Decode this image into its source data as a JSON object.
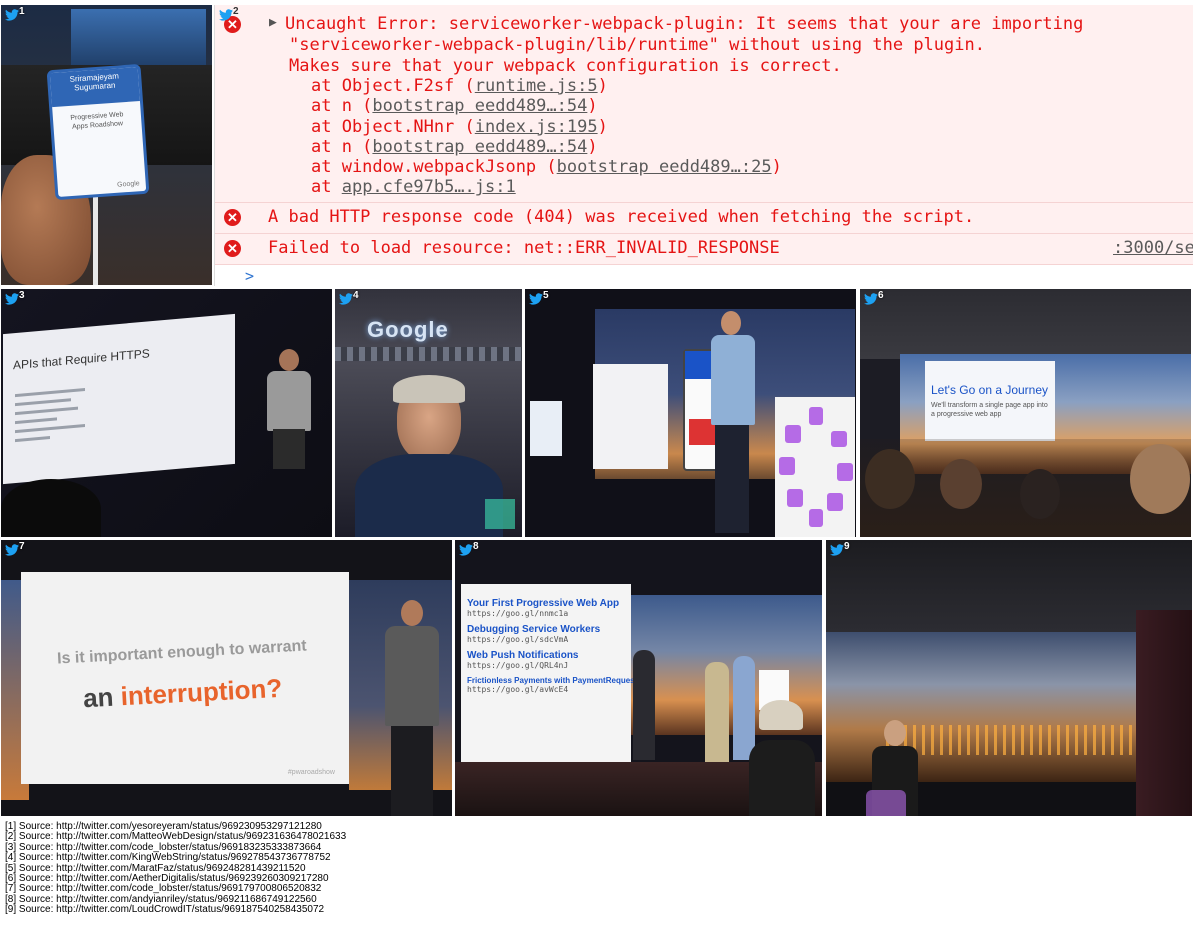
{
  "tiles": [
    {
      "number": "1"
    },
    {
      "number": "2"
    },
    {
      "number": "3"
    },
    {
      "number": "4"
    },
    {
      "number": "5"
    },
    {
      "number": "6"
    },
    {
      "number": "7"
    },
    {
      "number": "8"
    },
    {
      "number": "9"
    }
  ],
  "photo1": {
    "badge_name_line1": "Sriramajeyam",
    "badge_name_line2": "Sugumaran",
    "badge_sub": "Progressive Web Apps Roadshow",
    "badge_logo": "Google"
  },
  "console": {
    "error1": {
      "l1": "Uncaught Error: serviceworker-webpack-plugin: It seems that your are importing",
      "l2": "\"serviceworker-webpack-plugin/lib/runtime\" without using the plugin.",
      "l3": "Makes sure that your webpack configuration is correct.",
      "stack": [
        {
          "prefix": "at Object.F2sf (",
          "link": "runtime.js:5",
          "suffix": ")"
        },
        {
          "prefix": "at n (",
          "link": "bootstrap eedd489…:54",
          "suffix": ")"
        },
        {
          "prefix": "at Object.NHnr (",
          "link": "index.js:195",
          "suffix": ")"
        },
        {
          "prefix": "at n (",
          "link": "bootstrap eedd489…:54",
          "suffix": ")"
        },
        {
          "prefix": "at window.webpackJsonp (",
          "link": "bootstrap eedd489…:25",
          "suffix": ")"
        },
        {
          "prefix": "at ",
          "link": "app.cfe97b5….js:1",
          "suffix": ""
        }
      ]
    },
    "error2": "A bad HTTP response code (404) was received when fetching the script.",
    "error3": "Failed to load resource: net::ERR_INVALID_RESPONSE",
    "error3_link": ":3000/se",
    "prompt": ">"
  },
  "photo3": {
    "slide_title": "APIs that Require HTTPS"
  },
  "photo4": {
    "sign": "Google"
  },
  "photo6": {
    "slide_title": "Let's Go on a Journey",
    "slide_sub": "We'll transform a single page app into a progressive web app"
  },
  "photo7": {
    "line1": "Is it important enough to warrant",
    "line2a": "an ",
    "line2b": "interruption?",
    "accent": "#e8642c",
    "hashtag": "#pwaroadshow"
  },
  "photo8": {
    "items": [
      {
        "title": "Your First Progressive Web App",
        "url": "https://goo.gl/nnmc1a"
      },
      {
        "title": "Debugging Service Workers",
        "url": "https://goo.gl/sdcVmA"
      },
      {
        "title": "Web Push Notifications",
        "url": "https://goo.gl/QRL4nJ"
      },
      {
        "title": "Frictionless Payments with PaymentRequest API",
        "url": "https://goo.gl/avWcE4"
      }
    ]
  },
  "sources": [
    "[1] Source: http://twitter.com/yesoreyeram/status/969230953297121280",
    "[2] Source: http://twitter.com/MatteoWebDesign/status/969231636478021633",
    "[3] Source: http://twitter.com/code_lobster/status/969183235333873664",
    "[4] Source: http://twitter.com/KingWebString/status/969278543736778752",
    "[5] Source: http://twitter.com/MaratFaz/status/969248281439211520",
    "[6] Source: http://twitter.com/AetherDigitalis/status/969239260309217280",
    "[7] Source: http://twitter.com/code_lobster/status/969179700806520832",
    "[8] Source: http://twitter.com/andyianriley/status/969211686749122560",
    "[9] Source: http://twitter.com/LoudCrowdIT/status/969187540258435072"
  ],
  "colors": {
    "twitter": "#1da1f2",
    "console_error": "#e51414",
    "console_error_bg": "#fff0f0",
    "slide_bg": "#f4f4f4",
    "pwa_purple": "#b56be6",
    "slide_blue": "#1a53c7"
  }
}
